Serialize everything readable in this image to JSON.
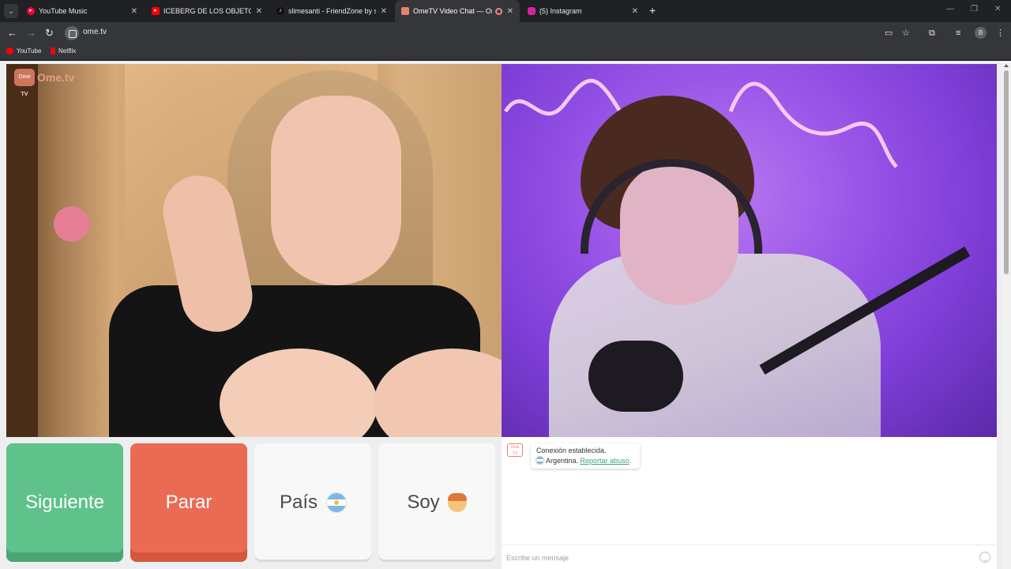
{
  "browser": {
    "tabs": [
      {
        "title": "YouTube Music",
        "favicon": "youtube-music-icon",
        "color": "#ff0033",
        "active": false
      },
      {
        "title": "ICEBERG DE LOS OBJETOS PERDIDOS",
        "favicon": "youtube-icon",
        "color": "#ff0000",
        "active": false
      },
      {
        "title": "slimesanti - FriendZone by slimesanti",
        "favicon": "tiktok-icon",
        "color": "#111111",
        "active": false
      },
      {
        "title": "OmeTV Video Chat — Omegle",
        "favicon": "ometv-icon",
        "color": "#e8826a",
        "active": true,
        "recording": true
      },
      {
        "title": "(5) Instagram",
        "favicon": "instagram-icon",
        "color": "#d6249f",
        "active": false
      }
    ],
    "address": "ome.tv",
    "bookmarks": [
      {
        "label": "YouTube",
        "icon": "youtube-icon",
        "color": "#ff0000"
      },
      {
        "label": "Netflix",
        "icon": "netflix-icon",
        "color": "#e50914"
      }
    ],
    "profile_initial": "B"
  },
  "logo": {
    "badge": "Ome TV",
    "wordmark": "Ome.tv"
  },
  "controls": {
    "next_label": "Siguiente",
    "stop_label": "Parar",
    "country_label": "País",
    "country_flag": "argentina-flag-icon",
    "gender_label": "Soy",
    "gender_icon": "boy-emoji-icon"
  },
  "chat": {
    "logo_text": "Ome TV",
    "system_message": "Conexión establecida.",
    "country_name": "Argentina.",
    "report_link": "Reportar abuso",
    "report_suffix": ".",
    "input_placeholder": "Escribe un mensaje"
  },
  "colors": {
    "next_green": "#5ec28a",
    "stop_red": "#ea6b54",
    "brand": "#e8826a"
  }
}
